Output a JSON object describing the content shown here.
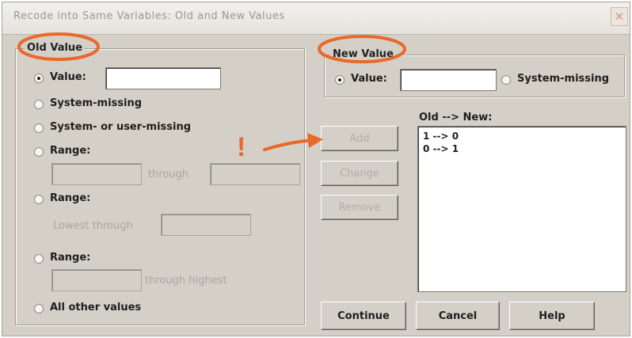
{
  "window": {
    "title": "Recode into Same Variables: Old and New Values",
    "close_glyph": "✕"
  },
  "old_value": {
    "group_label": "Old Value",
    "value_label": "Value:",
    "value_input": "",
    "system_missing_label": "System-missing",
    "system_or_user_missing_label": "System- or user-missing",
    "range1_label": "Range:",
    "range1_through": "through",
    "range2_label": "Range:",
    "range2_lowest_through": "Lowest through",
    "range3_label": "Range:",
    "range3_through_highest": "through highest",
    "all_other_label": "All other values",
    "selected": "value"
  },
  "new_value": {
    "group_label": "New Value",
    "value_label": "Value:",
    "value_input": "",
    "system_missing_label": "System-missing",
    "selected": "value"
  },
  "mapping": {
    "header": "Old --> New:",
    "items": [
      "1 --> 0",
      "0 --> 1"
    ]
  },
  "buttons": {
    "add": "Add",
    "change": "Change",
    "remove": "Remove",
    "continue": "Continue",
    "cancel": "Cancel",
    "help": "Help"
  },
  "annotation": {
    "mark": "!",
    "color": "#e8692a"
  }
}
